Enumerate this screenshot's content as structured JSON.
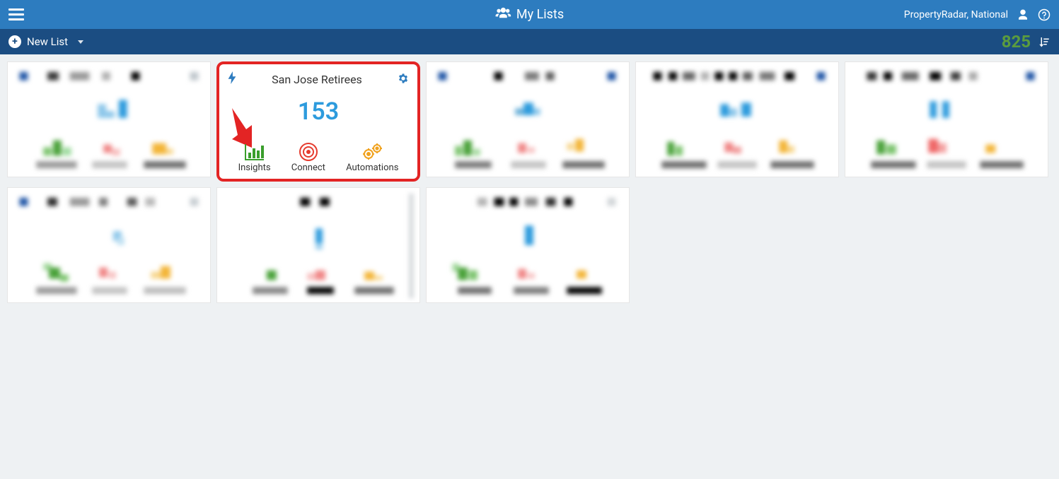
{
  "header": {
    "title": "My Lists",
    "user": "PropertyRadar, National"
  },
  "subbar": {
    "new_list_label": "New List",
    "total_count": "825"
  },
  "highlightCard": {
    "title": "San Jose Retirees",
    "count": "153",
    "actions": {
      "insights": "Insights",
      "connect": "Connect",
      "automations": "Automations"
    }
  },
  "colors": {
    "topbar": "#2d7cbf",
    "subbar": "#1b4d82",
    "accent_green": "#5b9c3e",
    "accent_blue": "#2d9bdd",
    "highlight_border": "#e32424"
  }
}
